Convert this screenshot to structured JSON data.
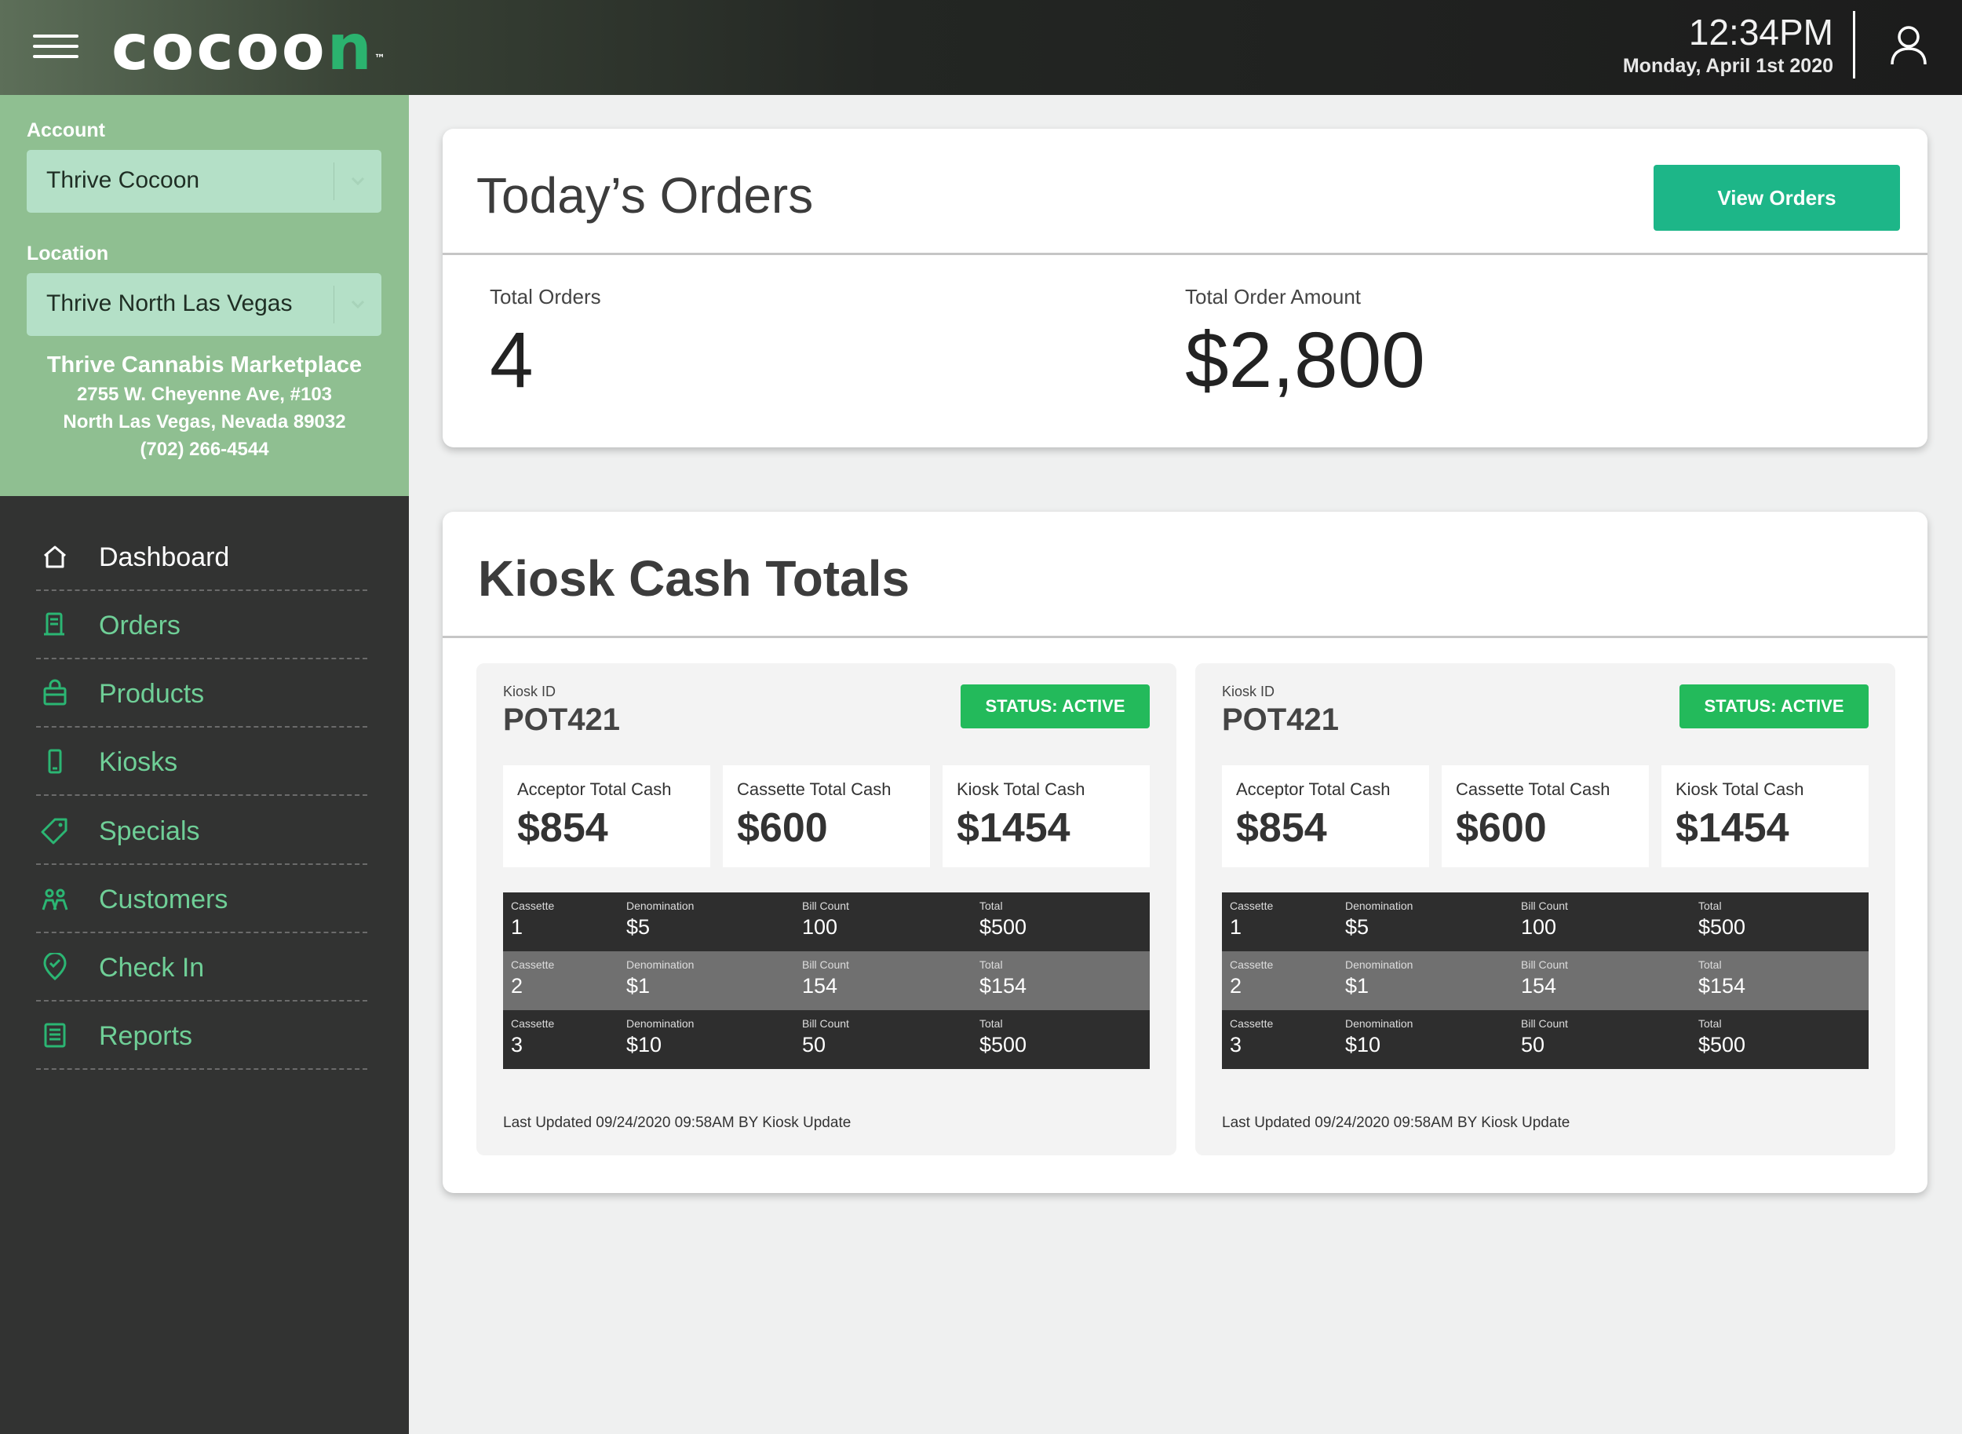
{
  "header": {
    "logo": {
      "pre": "cocoo",
      "accent": "n",
      "tm": "™"
    },
    "time": "12:34PM",
    "date": "Monday, April 1st 2020"
  },
  "sidebar": {
    "account_label": "Account",
    "account_value": "Thrive Cocoon",
    "location_label": "Location",
    "location_value": "Thrive North Las Vegas",
    "store_name": "Thrive Cannabis Marketplace",
    "address_1": "2755 W. Cheyenne Ave, #103",
    "address_2": "North Las Vegas, Nevada 89032",
    "phone": "(702) 266-4544",
    "nav": [
      {
        "label": "Dashboard",
        "icon": "home-icon",
        "active": true
      },
      {
        "label": "Orders",
        "icon": "receipt-icon"
      },
      {
        "label": "Products",
        "icon": "bag-icon"
      },
      {
        "label": "Kiosks",
        "icon": "kiosk-icon"
      },
      {
        "label": "Specials",
        "icon": "tag-icon"
      },
      {
        "label": "Customers",
        "icon": "people-icon"
      },
      {
        "label": "Check In",
        "icon": "checkin-icon"
      },
      {
        "label": "Reports",
        "icon": "report-icon"
      }
    ]
  },
  "orders": {
    "title": "Today’s Orders",
    "button": "View Orders",
    "total_orders_label": "Total Orders",
    "total_orders_value": "4",
    "total_amount_label": "Total Order Amount",
    "total_amount_value": "$2,800"
  },
  "kiosk_totals": {
    "title": "Kiosk Cash Totals",
    "kiosks": [
      {
        "id_label": "Kiosk ID",
        "id": "POT421",
        "status": "STATUS: ACTIVE",
        "acceptor_label": "Acceptor Total Cash",
        "acceptor_value": "$854",
        "cassette_label": "Cassette Total Cash",
        "cassette_value": "$600",
        "kiosk_label": "Kiosk Total Cash",
        "kiosk_value": "$1454",
        "col_headers": [
          "Cassette",
          "Denomination",
          "Bill Count",
          "Total"
        ],
        "rows": [
          [
            "1",
            "$5",
            "100",
            "$500"
          ],
          [
            "2",
            "$1",
            "154",
            "$154"
          ],
          [
            "3",
            "$10",
            "50",
            "$500"
          ]
        ],
        "updated": "Last Updated 09/24/2020 09:58AM BY Kiosk Update"
      },
      {
        "id_label": "Kiosk ID",
        "id": "POT421",
        "status": "STATUS: ACTIVE",
        "acceptor_label": "Acceptor Total Cash",
        "acceptor_value": "$854",
        "cassette_label": "Cassette Total Cash",
        "cassette_value": "$600",
        "kiosk_label": "Kiosk Total Cash",
        "kiosk_value": "$1454",
        "col_headers": [
          "Cassette",
          "Denomination",
          "Bill Count",
          "Total"
        ],
        "rows": [
          [
            "1",
            "$5",
            "100",
            "$500"
          ],
          [
            "2",
            "$1",
            "154",
            "$154"
          ],
          [
            "3",
            "$10",
            "50",
            "$500"
          ]
        ],
        "updated": "Last Updated 09/24/2020 09:58AM BY Kiosk Update"
      }
    ]
  },
  "colors": {
    "accent_green": "#1db688",
    "status_green": "#23ba5b",
    "nav_text_green": "#6fcf97",
    "sidebar_top": "#8fbf91",
    "sidebar_nav": "#323332"
  }
}
